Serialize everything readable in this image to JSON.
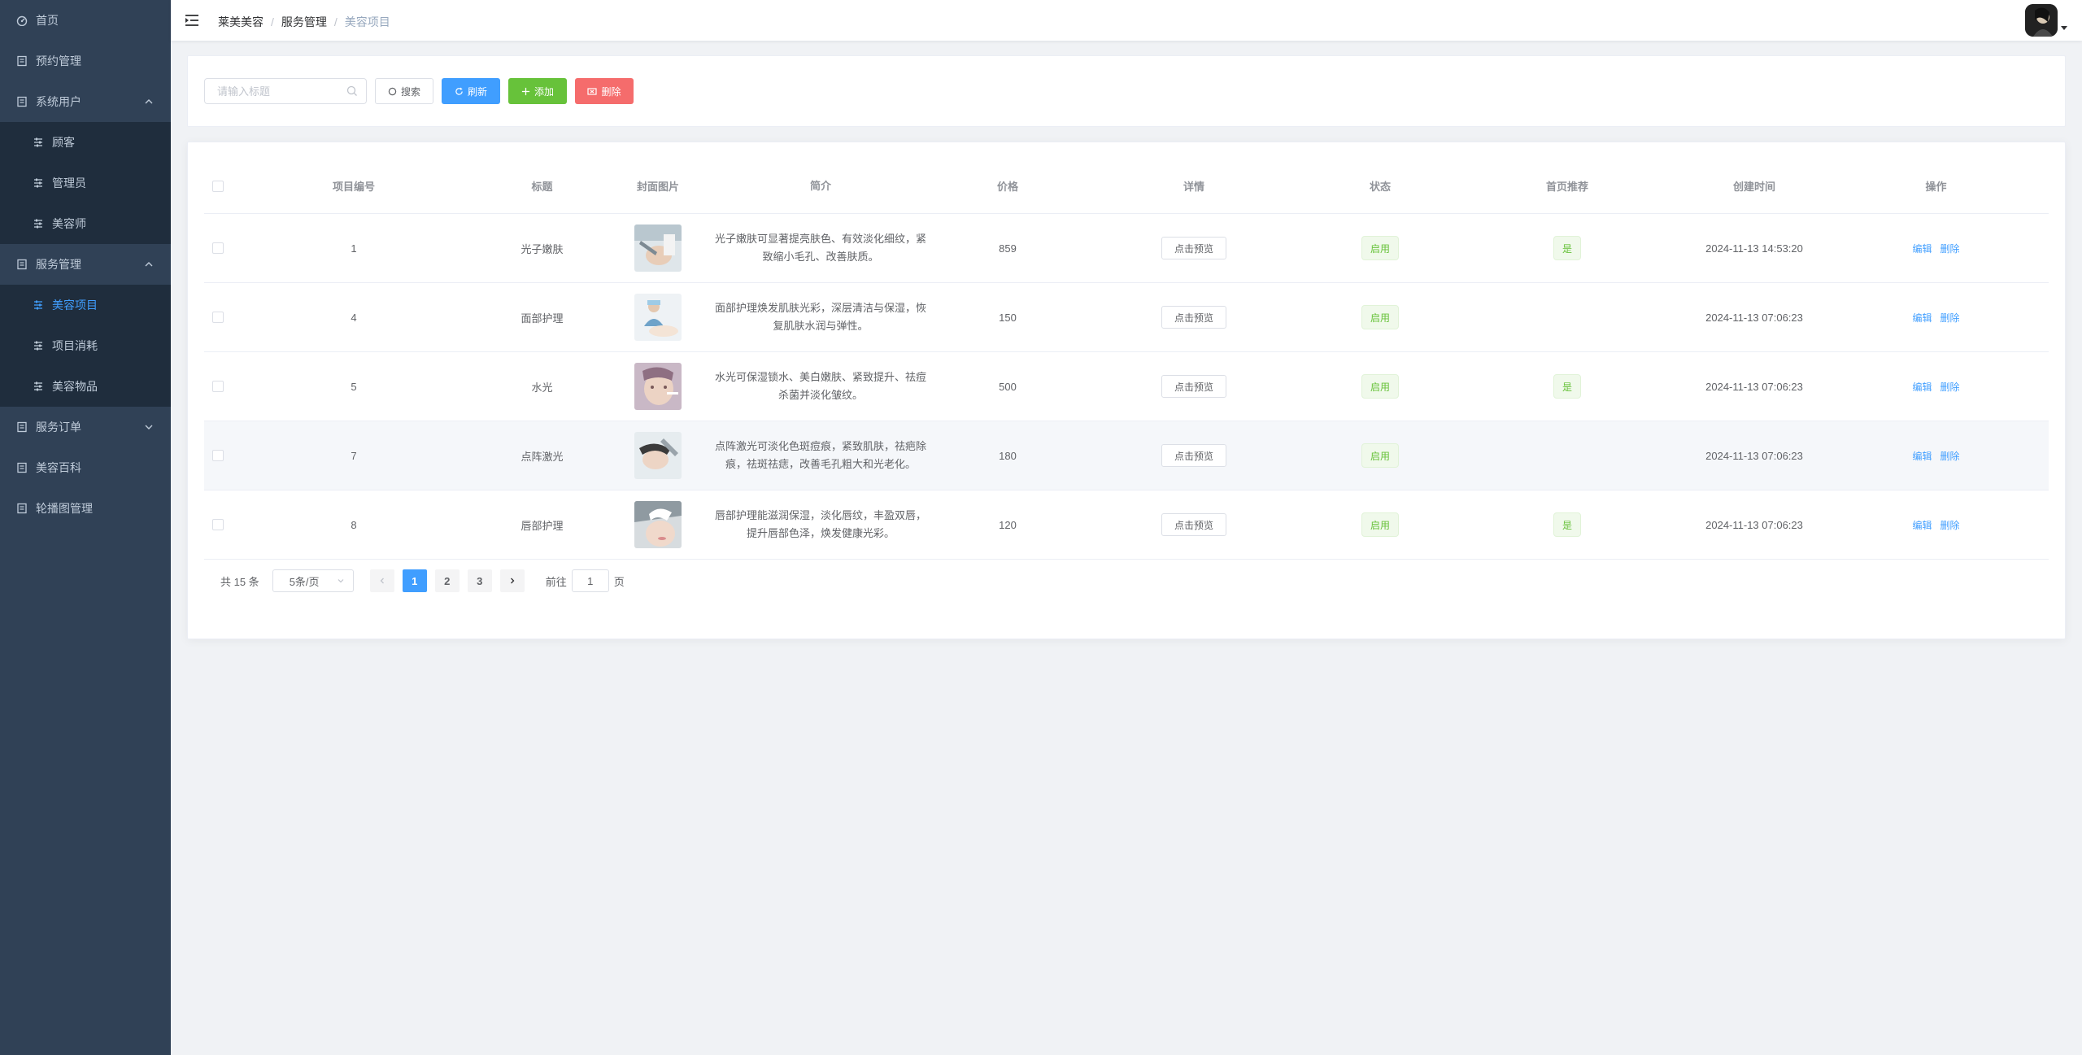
{
  "sidebar": {
    "items": [
      {
        "label": "首页",
        "icon": "dashboard-icon"
      },
      {
        "label": "预约管理",
        "icon": "document-icon"
      },
      {
        "label": "系统用户",
        "icon": "document-icon",
        "expanded": true,
        "children": [
          {
            "label": "顾客"
          },
          {
            "label": "管理员"
          },
          {
            "label": "美容师"
          }
        ]
      },
      {
        "label": "服务管理",
        "icon": "document-icon",
        "expanded": true,
        "children": [
          {
            "label": "美容项目",
            "active": true
          },
          {
            "label": "项目消耗"
          },
          {
            "label": "美容物品"
          }
        ]
      },
      {
        "label": "服务订单",
        "icon": "document-icon",
        "expanded": false
      },
      {
        "label": "美容百科",
        "icon": "document-icon"
      },
      {
        "label": "轮播图管理",
        "icon": "document-icon"
      }
    ]
  },
  "breadcrumb": [
    "莱美美容",
    "服务管理",
    "美容项目"
  ],
  "toolbar": {
    "search_placeholder": "请输入标题",
    "search_label": "搜索",
    "refresh_label": "刷新",
    "add_label": "添加",
    "delete_label": "删除"
  },
  "table": {
    "columns": [
      "项目编号",
      "标题",
      "封面图片",
      "简介",
      "价格",
      "详情",
      "状态",
      "首页推荐",
      "创建时间",
      "操作"
    ],
    "preview_label": "点击预览",
    "edit_label": "编辑",
    "delete_label": "删除",
    "rows": [
      {
        "id": "1",
        "title": "光子嫩肤",
        "desc": "光子嫩肤可显著提亮肤色、有效淡化细纹，紧致缩小毛孔、改善肤质。",
        "price": "859",
        "status": "启用",
        "recommend": "是",
        "created": "2024-11-13 14:53:20"
      },
      {
        "id": "4",
        "title": "面部护理",
        "desc": "面部护理焕发肌肤光彩，深层清洁与保湿，恢复肌肤水润与弹性。",
        "price": "150",
        "status": "启用",
        "recommend": "",
        "created": "2024-11-13 07:06:23"
      },
      {
        "id": "5",
        "title": "水光",
        "desc": "水光可保湿锁水、美白嫩肤、紧致提升、祛痘杀菌并淡化皱纹。",
        "price": "500",
        "status": "启用",
        "recommend": "是",
        "created": "2024-11-13 07:06:23"
      },
      {
        "id": "7",
        "title": "点阵激光",
        "desc": "点阵激光可淡化色斑痘痕，紧致肌肤，祛疤除痕，祛斑祛痣，改善毛孔粗大和光老化。",
        "price": "180",
        "status": "启用",
        "recommend": "",
        "created": "2024-11-13 07:06:23"
      },
      {
        "id": "8",
        "title": "唇部护理",
        "desc": "唇部护理能滋润保湿，淡化唇纹，丰盈双唇，提升唇部色泽，焕发健康光彩。",
        "price": "120",
        "status": "启用",
        "recommend": "是",
        "created": "2024-11-13 07:06:23"
      }
    ]
  },
  "pagination": {
    "total": "共 15 条",
    "page_size": "5条/页",
    "pages": [
      "1",
      "2",
      "3"
    ],
    "current": "1",
    "goto_prefix": "前往",
    "goto_value": "1",
    "goto_suffix": "页"
  },
  "colors": {
    "sidebar_bg": "#304156",
    "primary": "#409eff",
    "success": "#67c23a",
    "danger": "#f56c6c"
  }
}
